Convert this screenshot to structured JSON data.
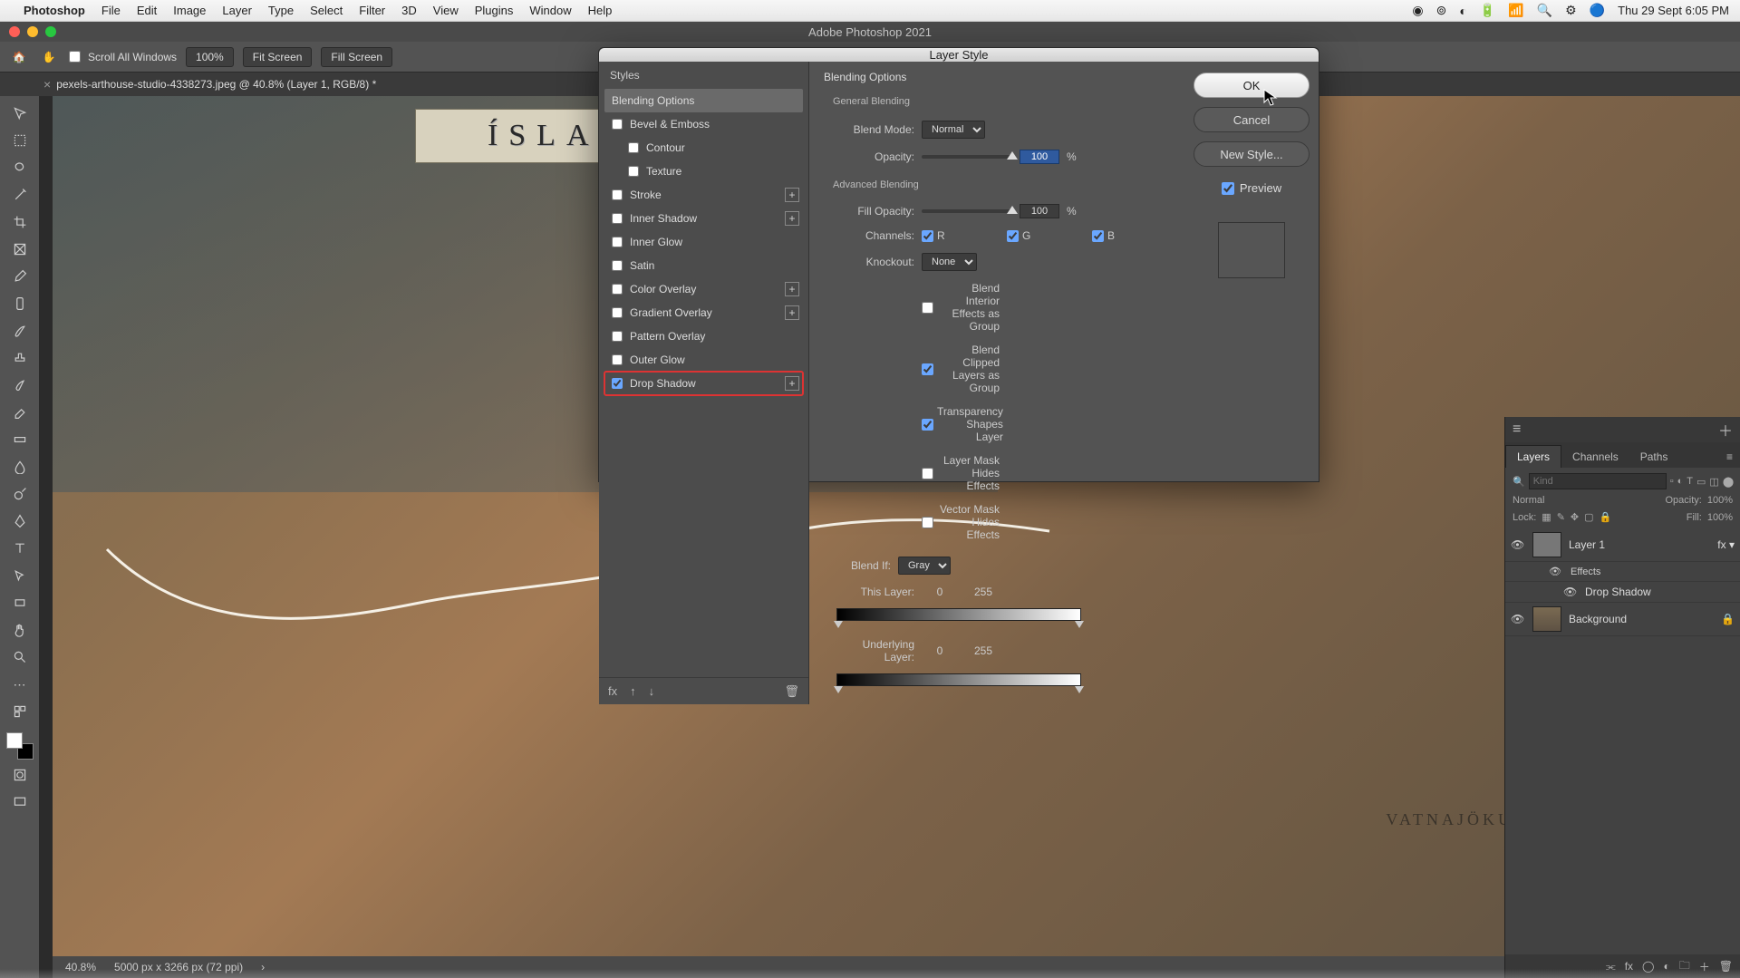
{
  "menubar": {
    "app": "Photoshop",
    "items": [
      "File",
      "Edit",
      "Image",
      "Layer",
      "Type",
      "Select",
      "Filter",
      "3D",
      "View",
      "Plugins",
      "Window",
      "Help"
    ],
    "clock": "Thu 29 Sept  6:05 PM"
  },
  "window": {
    "title": "Adobe Photoshop 2021"
  },
  "options": {
    "scroll_all": "Scroll All Windows",
    "zoom_field": "100%",
    "fit_screen": "Fit Screen",
    "fill_screen": "Fill Screen"
  },
  "doc_tab": {
    "name": "pexels-arthouse-studio-4338273.jpeg @ 40.8% (Layer 1, RGB/8) *"
  },
  "canvas": {
    "map_title": "ÍSLAN",
    "region_label": "VATNAJÖKULL"
  },
  "status": {
    "zoom": "40.8%",
    "dims": "5000 px x 3266 px (72 ppi)"
  },
  "dialog": {
    "title": "Layer Style",
    "styles_header": "Styles",
    "effects": {
      "blending_options": "Blending Options",
      "bevel": "Bevel & Emboss",
      "contour": "Contour",
      "texture": "Texture",
      "stroke": "Stroke",
      "inner_shadow": "Inner Shadow",
      "inner_glow": "Inner Glow",
      "satin": "Satin",
      "color_overlay": "Color Overlay",
      "gradient_overlay": "Gradient Overlay",
      "pattern_overlay": "Pattern Overlay",
      "outer_glow": "Outer Glow",
      "drop_shadow": "Drop Shadow"
    },
    "mid": {
      "section": "Blending Options",
      "general": "General Blending",
      "blend_mode_lbl": "Blend Mode:",
      "blend_mode_val": "Normal",
      "opacity_lbl": "Opacity:",
      "opacity_val": "100",
      "pct": "%",
      "advanced": "Advanced Blending",
      "fill_lbl": "Fill Opacity:",
      "fill_val": "100",
      "channels_lbl": "Channels:",
      "ch_r": "R",
      "ch_g": "G",
      "ch_b": "B",
      "knockout_lbl": "Knockout:",
      "knockout_val": "None",
      "blend_interior": "Blend Interior Effects as Group",
      "blend_clipped": "Blend Clipped Layers as Group",
      "transparency_shapes": "Transparency Shapes Layer",
      "layer_mask_hides": "Layer Mask Hides Effects",
      "vector_mask_hides": "Vector Mask Hides Effects",
      "blend_if_lbl": "Blend If:",
      "blend_if_val": "Gray",
      "this_layer_lbl": "This Layer:",
      "this_layer_lo": "0",
      "this_layer_hi": "255",
      "under_lbl": "Underlying Layer:",
      "under_lo": "0",
      "under_hi": "255"
    },
    "buttons": {
      "ok": "OK",
      "cancel": "Cancel",
      "new_style": "New Style...",
      "preview": "Preview"
    }
  },
  "layers_panel": {
    "tabs": [
      "Layers",
      "Channels",
      "Paths"
    ],
    "kind_placeholder": "Kind",
    "mode": "Normal",
    "opacity_lbl": "Opacity:",
    "opacity_val": "100%",
    "lock_lbl": "Lock:",
    "fill_lbl": "Fill:",
    "fill_val": "100%",
    "items": {
      "layer1": "Layer 1",
      "effects": "Effects",
      "drop_shadow": "Drop Shadow",
      "background": "Background"
    }
  }
}
